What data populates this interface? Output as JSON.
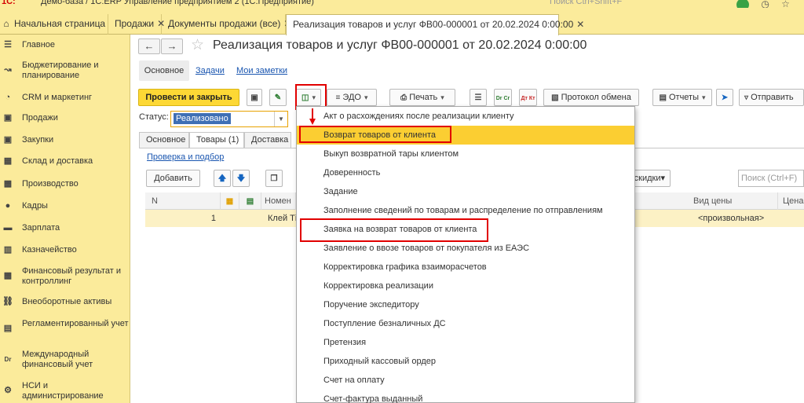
{
  "app": {
    "logo": "1С:",
    "title": "Демо-база / 1С:ERP Управление предприятием 2  (1С:Предприятие)",
    "search_placeholder": "Поиск Ctrl+Shift+F"
  },
  "tabs": [
    {
      "label": "Начальная страница",
      "closable": false
    },
    {
      "label": "Продажи",
      "closable": true
    },
    {
      "label": "Документы продажи (все)",
      "closable": true
    },
    {
      "label": "Реализация товаров и услуг ФВ00-000001 от 20.02.2024 0:00:00",
      "closable": true,
      "active": true
    }
  ],
  "sidebar": {
    "items": [
      {
        "label": "Главное",
        "icon": "menu-icon"
      },
      {
        "label": "Бюджетирование и планирование",
        "icon": "budget-icon"
      },
      {
        "label": "CRM и маркетинг",
        "icon": "crm-icon"
      },
      {
        "label": "Продажи",
        "icon": "sales-icon"
      },
      {
        "label": "Закупки",
        "icon": "cart-icon"
      },
      {
        "label": "Склад и доставка",
        "icon": "warehouse-icon"
      },
      {
        "label": "Производство",
        "icon": "factory-icon"
      },
      {
        "label": "Кадры",
        "icon": "person-icon"
      },
      {
        "label": "Зарплата",
        "icon": "salary-icon"
      },
      {
        "label": "Казначейство",
        "icon": "treasury-icon"
      },
      {
        "label": "Финансовый результат и контроллинг",
        "icon": "finance-icon"
      },
      {
        "label": "Внеоборотные активы",
        "icon": "assets-icon"
      },
      {
        "label": "Регламентированный учет",
        "icon": "accounting-icon"
      },
      {
        "label": "Международный финансовый учет",
        "icon": "dr-cr-icon"
      },
      {
        "label": "НСИ и администрирование",
        "icon": "gear-icon"
      }
    ]
  },
  "document": {
    "title": "Реализация товаров и услуг ФВ00-000001 от 20.02.2024 0:00:00",
    "subtabs": [
      "Основное",
      "Задачи",
      "Мои заметки"
    ],
    "toolbar": {
      "post_close": "Провести и закрыть",
      "edo": "ЭДО",
      "print": "Печать",
      "exchange_log": "Протокол обмена",
      "reports": "Отчеты",
      "send": "Отправить",
      "dr_cr": "Dr Cr",
      "dt_kt": "Дт Кт"
    },
    "status_label": "Статус:",
    "status_value": "Реализовано",
    "form_tabs": [
      "Основное",
      "Товары (1)",
      "Доставка"
    ],
    "pick_link": "Проверка и подбор",
    "add_button": "Добавить",
    "discounts_button": "скидки",
    "table_search_placeholder": "Поиск (Ctrl+F)",
    "columns": [
      "N",
      "Номен",
      "Вид цены",
      "Цена"
    ],
    "rows": [
      {
        "n": "1",
        "nomenclature": "Клей Ті",
        "price_type": "<произвольная>"
      }
    ]
  },
  "menu": {
    "items": [
      "Акт о расхождениях после реализации клиенту",
      "Возврат товаров от клиента",
      "Выкуп возвратной тары клиентом",
      "Доверенность",
      "Задание",
      "Заполнение сведений по товарам и распределение по отправлениям",
      "Заявка на возврат товаров от клиента",
      "Заявление о ввозе товаров от покупателя из ЕАЭС",
      "Корректировка графика взаиморасчетов",
      "Корректировка реализации",
      "Поручение экспедитору",
      "Поступление безналичных ДС",
      "Претензия",
      "Приходный кассовый ордер",
      "Счет на оплату",
      "Счет-фактура выданный"
    ],
    "highlighted_index": 1
  },
  "colors": {
    "panel_yellow": "#fbeb9b",
    "primary_button": "#fdd835",
    "menu_highlight": "#fbce32",
    "annotation_red": "#e10000",
    "link_blue": "#1a56b0"
  }
}
